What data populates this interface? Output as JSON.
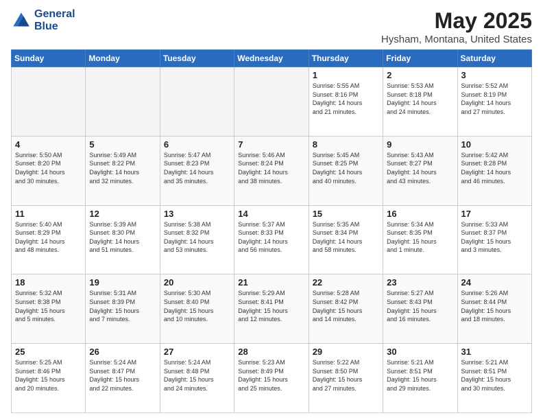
{
  "header": {
    "logo_line1": "General",
    "logo_line2": "Blue",
    "title": "May 2025",
    "subtitle": "Hysham, Montana, United States"
  },
  "days_of_week": [
    "Sunday",
    "Monday",
    "Tuesday",
    "Wednesday",
    "Thursday",
    "Friday",
    "Saturday"
  ],
  "weeks": [
    [
      {
        "day": "",
        "info": ""
      },
      {
        "day": "",
        "info": ""
      },
      {
        "day": "",
        "info": ""
      },
      {
        "day": "",
        "info": ""
      },
      {
        "day": "1",
        "info": "Sunrise: 5:55 AM\nSunset: 8:16 PM\nDaylight: 14 hours\nand 21 minutes."
      },
      {
        "day": "2",
        "info": "Sunrise: 5:53 AM\nSunset: 8:18 PM\nDaylight: 14 hours\nand 24 minutes."
      },
      {
        "day": "3",
        "info": "Sunrise: 5:52 AM\nSunset: 8:19 PM\nDaylight: 14 hours\nand 27 minutes."
      }
    ],
    [
      {
        "day": "4",
        "info": "Sunrise: 5:50 AM\nSunset: 8:20 PM\nDaylight: 14 hours\nand 30 minutes."
      },
      {
        "day": "5",
        "info": "Sunrise: 5:49 AM\nSunset: 8:22 PM\nDaylight: 14 hours\nand 32 minutes."
      },
      {
        "day": "6",
        "info": "Sunrise: 5:47 AM\nSunset: 8:23 PM\nDaylight: 14 hours\nand 35 minutes."
      },
      {
        "day": "7",
        "info": "Sunrise: 5:46 AM\nSunset: 8:24 PM\nDaylight: 14 hours\nand 38 minutes."
      },
      {
        "day": "8",
        "info": "Sunrise: 5:45 AM\nSunset: 8:25 PM\nDaylight: 14 hours\nand 40 minutes."
      },
      {
        "day": "9",
        "info": "Sunrise: 5:43 AM\nSunset: 8:27 PM\nDaylight: 14 hours\nand 43 minutes."
      },
      {
        "day": "10",
        "info": "Sunrise: 5:42 AM\nSunset: 8:28 PM\nDaylight: 14 hours\nand 46 minutes."
      }
    ],
    [
      {
        "day": "11",
        "info": "Sunrise: 5:40 AM\nSunset: 8:29 PM\nDaylight: 14 hours\nand 48 minutes."
      },
      {
        "day": "12",
        "info": "Sunrise: 5:39 AM\nSunset: 8:30 PM\nDaylight: 14 hours\nand 51 minutes."
      },
      {
        "day": "13",
        "info": "Sunrise: 5:38 AM\nSunset: 8:32 PM\nDaylight: 14 hours\nand 53 minutes."
      },
      {
        "day": "14",
        "info": "Sunrise: 5:37 AM\nSunset: 8:33 PM\nDaylight: 14 hours\nand 56 minutes."
      },
      {
        "day": "15",
        "info": "Sunrise: 5:35 AM\nSunset: 8:34 PM\nDaylight: 14 hours\nand 58 minutes."
      },
      {
        "day": "16",
        "info": "Sunrise: 5:34 AM\nSunset: 8:35 PM\nDaylight: 15 hours\nand 1 minute."
      },
      {
        "day": "17",
        "info": "Sunrise: 5:33 AM\nSunset: 8:37 PM\nDaylight: 15 hours\nand 3 minutes."
      }
    ],
    [
      {
        "day": "18",
        "info": "Sunrise: 5:32 AM\nSunset: 8:38 PM\nDaylight: 15 hours\nand 5 minutes."
      },
      {
        "day": "19",
        "info": "Sunrise: 5:31 AM\nSunset: 8:39 PM\nDaylight: 15 hours\nand 7 minutes."
      },
      {
        "day": "20",
        "info": "Sunrise: 5:30 AM\nSunset: 8:40 PM\nDaylight: 15 hours\nand 10 minutes."
      },
      {
        "day": "21",
        "info": "Sunrise: 5:29 AM\nSunset: 8:41 PM\nDaylight: 15 hours\nand 12 minutes."
      },
      {
        "day": "22",
        "info": "Sunrise: 5:28 AM\nSunset: 8:42 PM\nDaylight: 15 hours\nand 14 minutes."
      },
      {
        "day": "23",
        "info": "Sunrise: 5:27 AM\nSunset: 8:43 PM\nDaylight: 15 hours\nand 16 minutes."
      },
      {
        "day": "24",
        "info": "Sunrise: 5:26 AM\nSunset: 8:44 PM\nDaylight: 15 hours\nand 18 minutes."
      }
    ],
    [
      {
        "day": "25",
        "info": "Sunrise: 5:25 AM\nSunset: 8:46 PM\nDaylight: 15 hours\nand 20 minutes."
      },
      {
        "day": "26",
        "info": "Sunrise: 5:24 AM\nSunset: 8:47 PM\nDaylight: 15 hours\nand 22 minutes."
      },
      {
        "day": "27",
        "info": "Sunrise: 5:24 AM\nSunset: 8:48 PM\nDaylight: 15 hours\nand 24 minutes."
      },
      {
        "day": "28",
        "info": "Sunrise: 5:23 AM\nSunset: 8:49 PM\nDaylight: 15 hours\nand 25 minutes."
      },
      {
        "day": "29",
        "info": "Sunrise: 5:22 AM\nSunset: 8:50 PM\nDaylight: 15 hours\nand 27 minutes."
      },
      {
        "day": "30",
        "info": "Sunrise: 5:21 AM\nSunset: 8:51 PM\nDaylight: 15 hours\nand 29 minutes."
      },
      {
        "day": "31",
        "info": "Sunrise: 5:21 AM\nSunset: 8:51 PM\nDaylight: 15 hours\nand 30 minutes."
      }
    ]
  ]
}
